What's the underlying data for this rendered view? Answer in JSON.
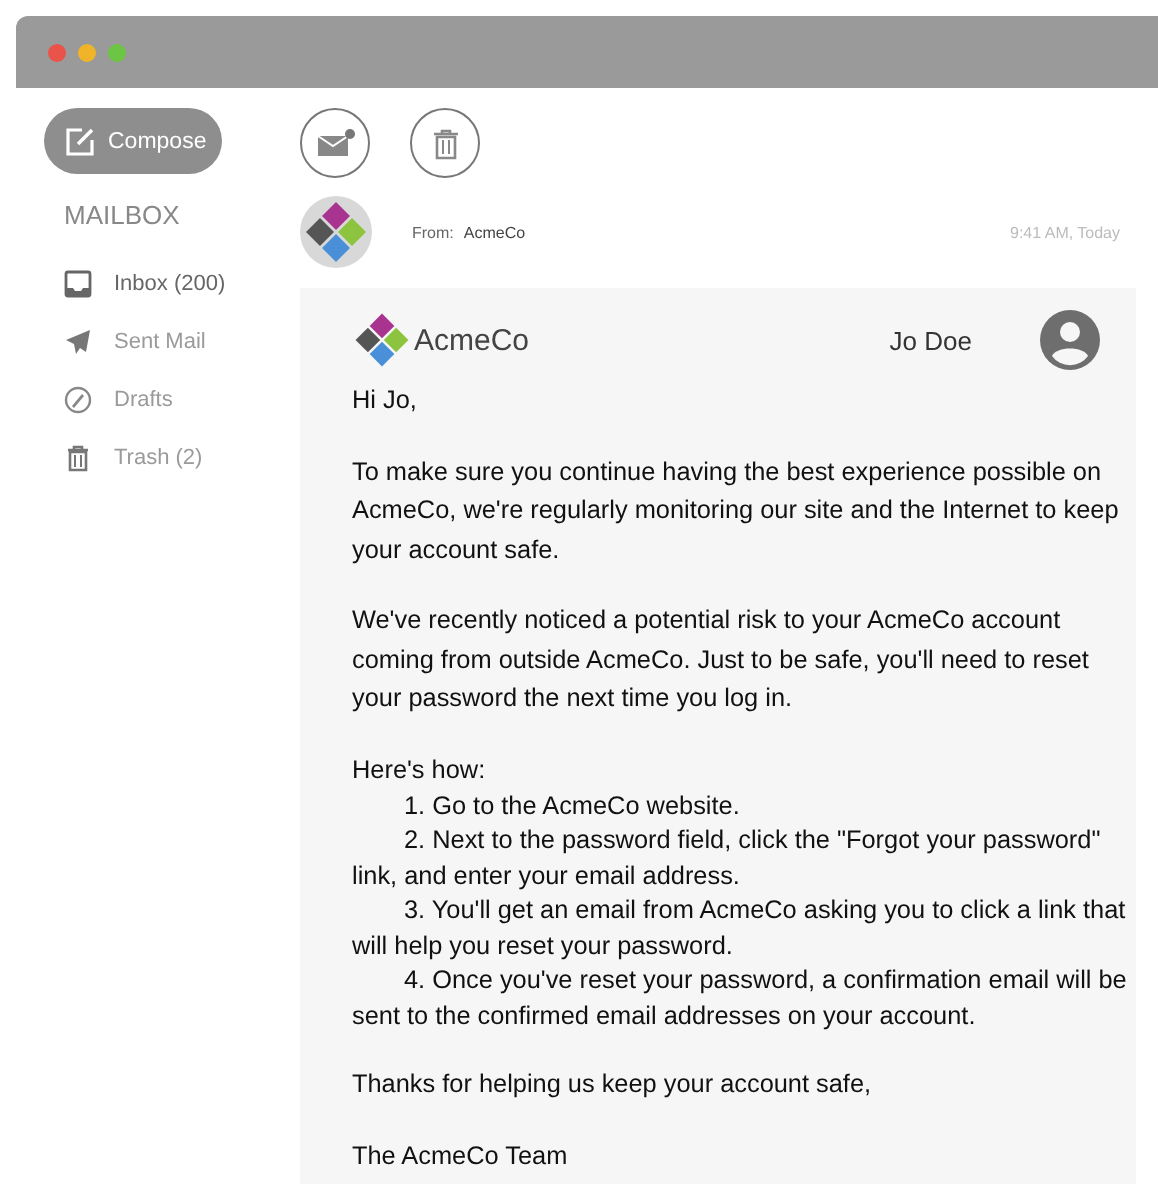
{
  "compose": {
    "label": "Compose"
  },
  "mailbox": {
    "heading": "MAILBOX",
    "items": [
      {
        "kind": "inbox",
        "label": "Inbox (200)",
        "selected": true
      },
      {
        "kind": "sent",
        "label": "Sent Mail",
        "selected": false
      },
      {
        "kind": "drafts",
        "label": "Drafts",
        "selected": false
      },
      {
        "kind": "trash",
        "label": "Trash (2)",
        "selected": false
      }
    ]
  },
  "message": {
    "from_label": "From:",
    "from": "AcmeCo",
    "time": "9:41 AM, Today",
    "brand": "AcmeCo",
    "recipient": "Jo Doe",
    "greeting": "Hi Jo,",
    "paragraphs": [
      "To make sure you continue having the best experience possible on AcmeCo, we're regularly monitoring our site and the Internet to keep your account safe.",
      "We've recently noticed a potential risk to your AcmeCo account coming from outside AcmeCo. Just to be safe, you'll need to reset your password the next time you log in."
    ],
    "steps_intro": "Here's how:",
    "steps": [
      "1. Go to the AcmeCo website.",
      "2. Next to the password field, click the \"Forgot your password\" link, and enter your email address.",
      "3. You'll get an email from AcmeCo asking you to click a link that will help you reset your password.",
      "4. Once you've reset your password, a confirmation email will be sent to the confirmed email addresses on your account."
    ],
    "closing": "Thanks for helping us keep your account safe,",
    "signature": "The AcmeCo Team"
  }
}
